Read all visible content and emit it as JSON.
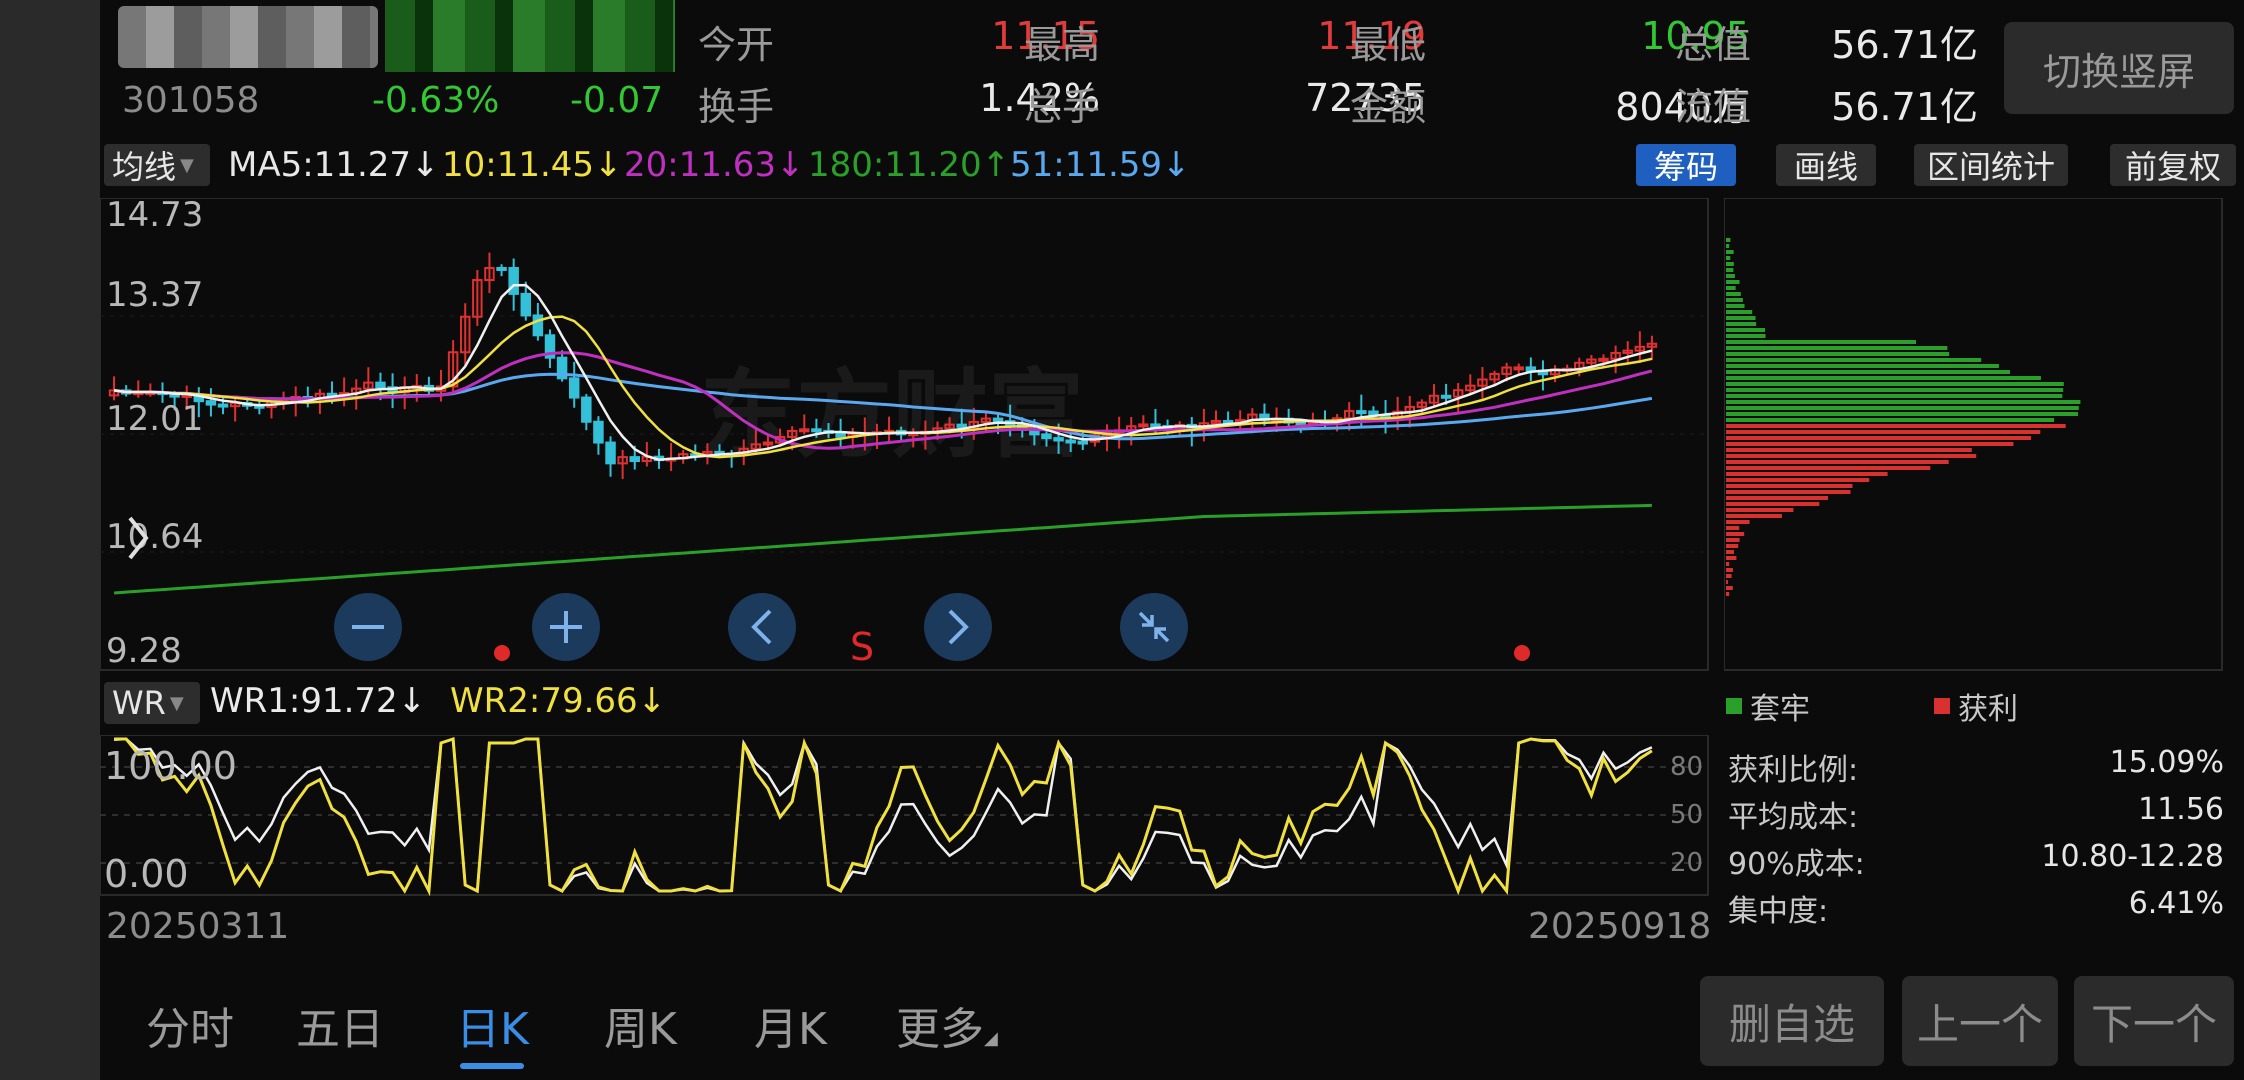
{
  "header": {
    "code": "301058",
    "change_pct": "-0.63%",
    "change_abs": "-0.07",
    "quote_rows": [
      [
        {
          "label": "今开",
          "value": "11.15",
          "color": "#e23b3b"
        },
        {
          "label": "最高",
          "value": "11.19",
          "color": "#e23b3b"
        },
        {
          "label": "最低",
          "value": "10.95",
          "color": "#33c733"
        },
        {
          "label": "总值",
          "value": "56.71亿",
          "color": "#eaeaea"
        }
      ],
      [
        {
          "label": "换手",
          "value": "1.42%",
          "color": "#eaeaea"
        },
        {
          "label": "总手",
          "value": "72735",
          "color": "#eaeaea"
        },
        {
          "label": "金额",
          "value": "8040万",
          "color": "#eaeaea"
        },
        {
          "label": "流值",
          "value": "56.71亿",
          "color": "#eaeaea"
        }
      ]
    ],
    "switch_button": "切换竖屏"
  },
  "ma_bar": {
    "selector": "均线",
    "ma5": {
      "text": "MA5:11.27↓",
      "color": "#e8e8e8"
    },
    "ma10": {
      "text": "10:11.45↓",
      "color": "#f0e040"
    },
    "ma20": {
      "text": "20:11.63↓",
      "color": "#c030c0"
    },
    "ma180": {
      "text": "180:11.20↑",
      "color": "#2aa02a"
    },
    "ma51": {
      "text": "51:11.59↓",
      "color": "#5aa9f0"
    },
    "buttons": [
      "筹码",
      "画线",
      "区间统计",
      "前复权"
    ]
  },
  "main_chart": {
    "y_ticks": [
      "14.73",
      "13.37",
      "12.01",
      "10.64",
      "9.28"
    ],
    "watermark": "东方财富",
    "marker_s": "S"
  },
  "wr_bar": {
    "selector": "WR",
    "wr1": {
      "text": "WR1:91.72↓",
      "color": "#eaeaea"
    },
    "wr2": {
      "text": "WR2:79.66↓",
      "color": "#f0e040"
    }
  },
  "wr_chart": {
    "y_ticks_left": [
      "100.00",
      "0.00"
    ],
    "y_ticks_right": [
      "80",
      "50",
      "20"
    ]
  },
  "dates": {
    "start": "20250311",
    "end": "20250918"
  },
  "chip_panel": {
    "legend": [
      {
        "label": "套牢",
        "color": "#2aa02a"
      },
      {
        "label": "获利",
        "color": "#d93030"
      }
    ],
    "stats": [
      {
        "label": "获利比例:",
        "value": "15.09%"
      },
      {
        "label": "平均成本:",
        "value": "11.56"
      },
      {
        "label": "90%成本:",
        "value": "10.80-12.28"
      },
      {
        "label": "集中度:",
        "value": "6.41%"
      }
    ]
  },
  "tabs": [
    "分时",
    "五日",
    "日K",
    "周K",
    "月K",
    "更多"
  ],
  "active_tab": "日K",
  "bottom_buttons": [
    "删自选",
    "上一个",
    "下一个"
  ]
}
